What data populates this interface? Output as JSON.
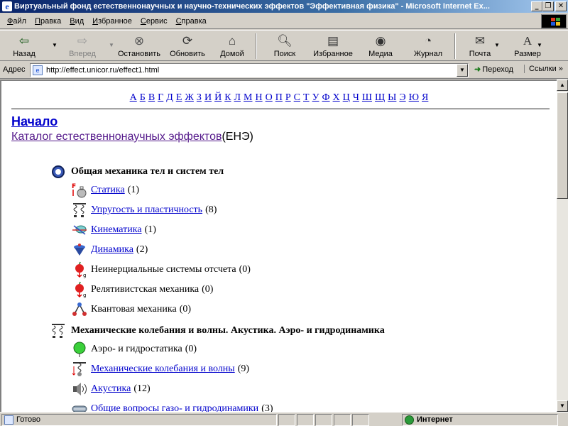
{
  "window": {
    "title": "Виртуальный фонд естественнонаучных и научно-технических эффектов \"Эффективная физика\" - Microsoft Internet Ex..."
  },
  "menu": [
    {
      "label": "Файл",
      "u": "Ф",
      "rest": "айл"
    },
    {
      "label": "Правка",
      "u": "П",
      "rest": "равка"
    },
    {
      "label": "Вид",
      "u": "В",
      "rest": "ид"
    },
    {
      "label": "Избранное",
      "u": "И",
      "rest": "збранное"
    },
    {
      "label": "Сервис",
      "u": "С",
      "rest": "ервис"
    },
    {
      "label": "Справка",
      "u": "С",
      "rest": "правка"
    }
  ],
  "toolbar": {
    "back": "Назад",
    "forward": "Вперед",
    "stop": "Остановить",
    "refresh": "Обновить",
    "home": "Домой",
    "search": "Поиск",
    "favorites": "Избранное",
    "media": "Медиа",
    "history": "Журнал",
    "mail": "Почта",
    "size": "Размер"
  },
  "address": {
    "label": "Адрес",
    "url": "http://effect.unicor.ru/effect1.html",
    "go": "Переход",
    "links": "Ссылки"
  },
  "page": {
    "alphabet": [
      "А",
      "Б",
      "В",
      "Г",
      "Д",
      "Е",
      "Ж",
      "З",
      "И",
      "Й",
      "К",
      "Л",
      "М",
      "Н",
      "О",
      "П",
      "Р",
      "С",
      "Т",
      "У",
      "Ф",
      "Х",
      "Ц",
      "Ч",
      "Ш",
      "Щ",
      "Ы",
      "Э",
      "Ю",
      "Я"
    ],
    "home_link": "Начало",
    "catalog_link": "Каталог естественнонаучных эффектов",
    "catalog_suffix": "(ЕНЭ)",
    "sections": [
      {
        "title": "Общая механика тел и систем тел",
        "icon": "ring-icon",
        "items": [
          {
            "label": "Статика",
            "count": "(1)",
            "link": true,
            "icon": "weight-icon"
          },
          {
            "label": "Упругость и пластичность",
            "count": "(8)",
            "link": true,
            "icon": "spring-icon"
          },
          {
            "label": "Кинематика",
            "count": "(1)",
            "link": true,
            "icon": "kinematics-icon"
          },
          {
            "label": "Динамика",
            "count": "(2)",
            "link": true,
            "icon": "spinning-top-icon"
          },
          {
            "label": "Неинерциальные системы отсчета",
            "count": "(0)",
            "link": false,
            "icon": "apple-icon"
          },
          {
            "label": "Релятивистская механика",
            "count": "(0)",
            "link": false,
            "icon": "apple-icon"
          },
          {
            "label": "Квантовая механика",
            "count": "(0)",
            "link": false,
            "icon": "molecule-icon"
          }
        ]
      },
      {
        "title": "Механические колебания и волны. Акустика. Аэро- и гидродинамика",
        "icon": "spring-icon",
        "items": [
          {
            "label": "Аэро- и гидростатика",
            "count": "(0)",
            "link": false,
            "icon": "balloon-icon"
          },
          {
            "label": "Механические колебания и волны",
            "count": "(9)",
            "link": true,
            "icon": "pendulum-icon"
          },
          {
            "label": "Акустика",
            "count": "(12)",
            "link": true,
            "icon": "speaker-icon"
          },
          {
            "label": "Общие вопросы газо- и гидродинамики",
            "count": "(3)",
            "link": true,
            "icon": "flow-icon"
          }
        ]
      }
    ]
  },
  "status": {
    "text": "Готово",
    "zone": "Интернет"
  }
}
